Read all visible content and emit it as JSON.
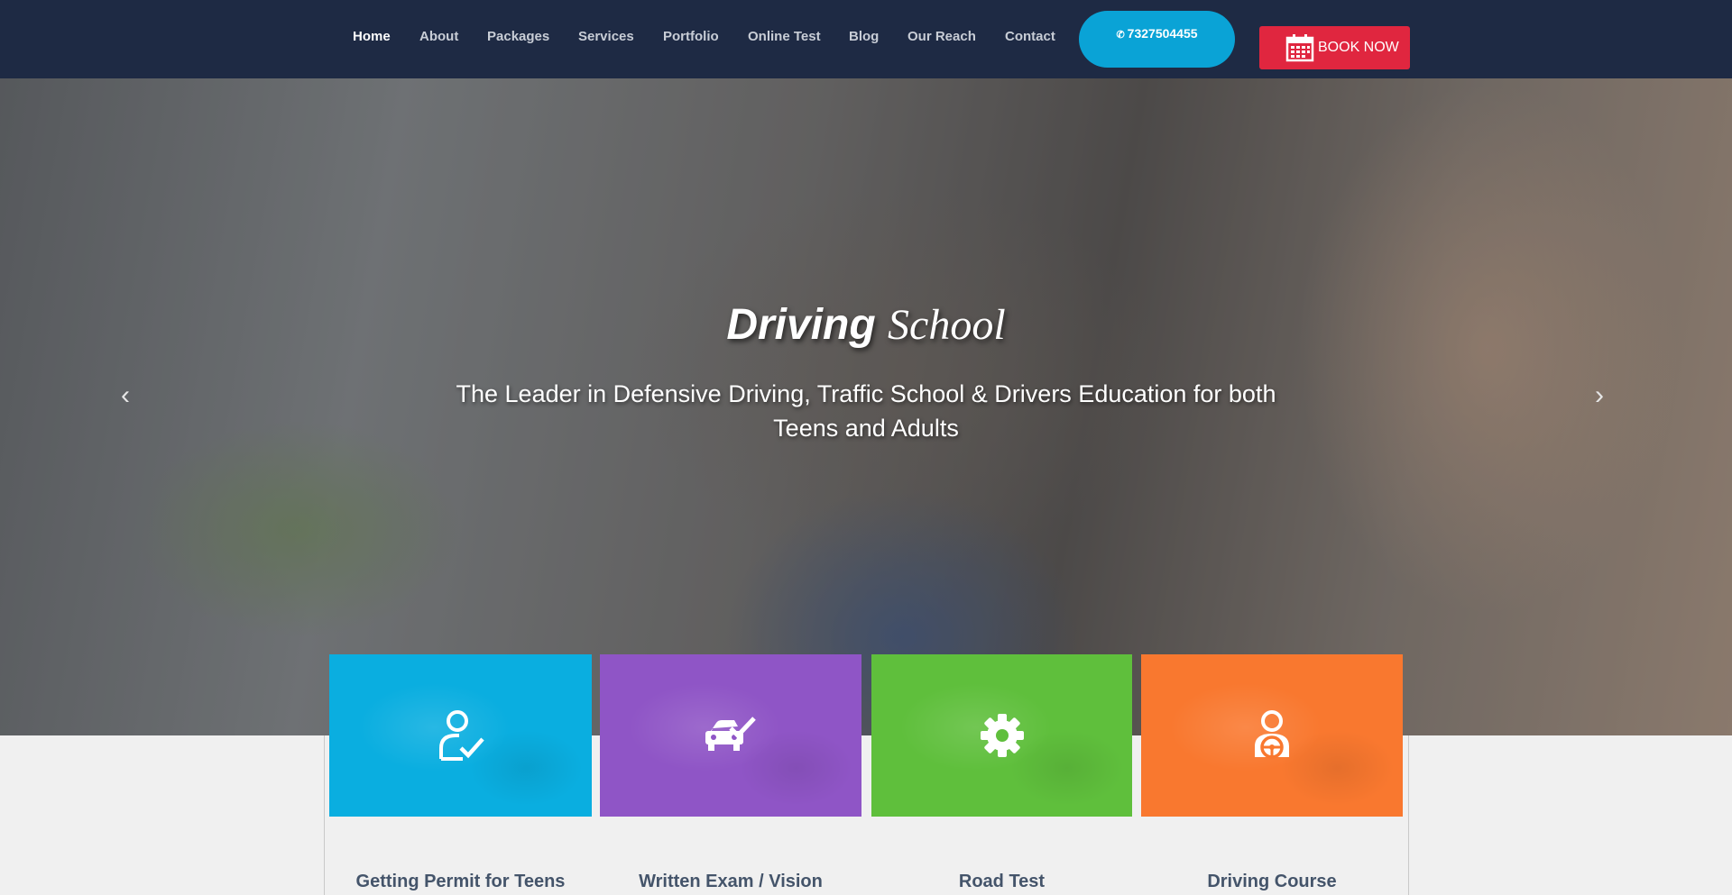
{
  "nav": {
    "items": [
      {
        "label": "Home",
        "active": true
      },
      {
        "label": "About"
      },
      {
        "label": "Packages"
      },
      {
        "label": "Services"
      },
      {
        "label": "Portfolio"
      },
      {
        "label": "Online Test"
      },
      {
        "label": "Blog"
      },
      {
        "label": "Our Reach"
      },
      {
        "label": "Contact"
      }
    ],
    "phone": "7327504455",
    "phone_icon": "phone-icon",
    "book_label": "BOOK NOW",
    "book_icon": "calendar-icon"
  },
  "hero": {
    "title_bold": "Driving",
    "title_serif": "School",
    "subtitle": "The Leader in Defensive Driving, Traffic School & Drivers Education for both Teens and Adults",
    "prev_icon": "chevron-left-icon",
    "next_icon": "chevron-right-icon"
  },
  "services": [
    {
      "label": "Getting Permit for Teens",
      "icon": "user-check-icon",
      "color": "#0aaee0"
    },
    {
      "label": "Written Exam / Vision",
      "icon": "car-check-icon",
      "color": "#8f55c6"
    },
    {
      "label": "Road Test",
      "icon": "gear-icon",
      "color": "#5fbf3c"
    },
    {
      "label": "Driving Course",
      "icon": "driver-icon",
      "color": "#f9782f"
    }
  ],
  "colors": {
    "nav_bg": "#1e2a44",
    "phone_bg": "#0aa3d6",
    "book_bg": "#e0263f"
  }
}
